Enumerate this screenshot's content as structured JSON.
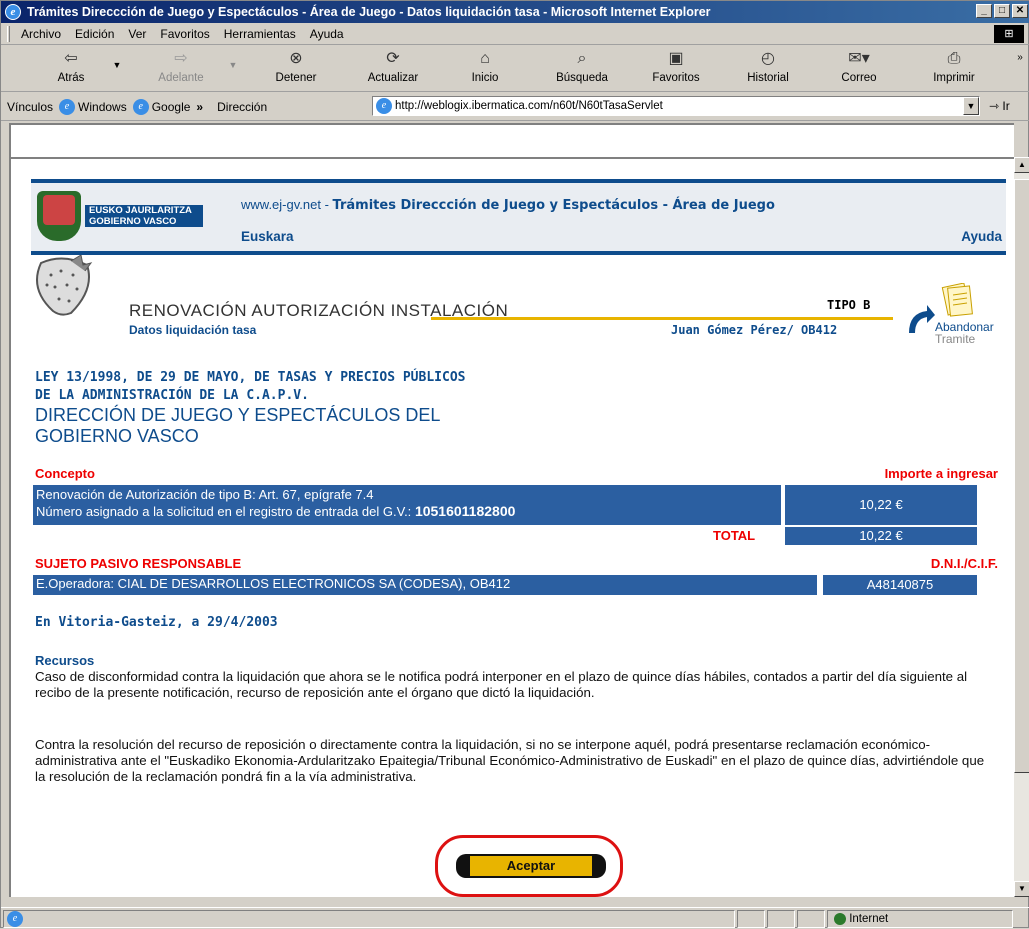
{
  "window": {
    "title": "Trámites Direccción de Juego y Espectáculos - Área de Juego - Datos liquidación tasa - Microsoft Internet Explorer"
  },
  "menu": [
    "Archivo",
    "Edición",
    "Ver",
    "Favoritos",
    "Herramientas",
    "Ayuda"
  ],
  "toolbar": {
    "back": "Atrás",
    "forward": "Adelante",
    "stop": "Detener",
    "refresh": "Actualizar",
    "home": "Inicio",
    "search": "Búsqueda",
    "favorites": "Favoritos",
    "history": "Historial",
    "mail": "Correo",
    "print": "Imprimir"
  },
  "links": {
    "label": "Vínculos",
    "windows": "Windows",
    "google": "Google",
    "more": "»",
    "address_label": "Dirección",
    "url": "http://weblogix.ibermatica.com/n60t/N60tTasaServlet",
    "go": "Ir"
  },
  "banner": {
    "logo_text": "EUSKO JAURLARITZA GOBIERNO VASCO",
    "site": "www.ej-gv.net",
    "sep": " - ",
    "site_title": "Trámites Direccción de Juego y Espectáculos - Área de Juego",
    "euskara": "Euskara",
    "ayuda": "Ayuda"
  },
  "procedure": {
    "title": "RENOVACIÓN AUTORIZACIÓN INSTALACIÓN",
    "tipo": "TIPO B",
    "subtitle": "Datos liquidación tasa",
    "user": "Juan Gómez Pérez/ OB412",
    "abandon_1": "Abandonar",
    "abandon_2": "Tramite"
  },
  "law": {
    "line1": "LEY 13/1998, DE 29 DE MAYO, DE TASAS Y PRECIOS PÚBLICOS",
    "line2": "DE LA ADMINISTRACIÓN DE LA C.A.P.V.",
    "line3": "DIRECCIÓN DE JUEGO Y ESPECTÁCULOS DEL",
    "line4": "GOBIERNO VASCO"
  },
  "concept": {
    "header": "Concepto",
    "amount_header": "Importe a ingresar",
    "line1": "Renovación de Autorización de tipo B: Art. 67, epígrafe 7.4",
    "line2": "Número asignado a la solicitud en el registro de entrada del G.V.:",
    "reg_number": "1051601182800",
    "amount": "10,22 €",
    "total_label": "TOTAL",
    "total": "10,22 €"
  },
  "subject": {
    "header": "SUJETO PASIVO RESPONSABLE",
    "id_header": "D.N.I./C.I.F.",
    "name": "E.Operadora: CIAL DE DESARROLLOS ELECTRONICOS SA (CODESA), OB412",
    "id": "A48140875"
  },
  "place_date": "En Vitoria-Gasteiz, a 29/4/2003",
  "resources": {
    "header": "Recursos",
    "p1": "Caso de disconformidad contra la liquidación que ahora se le notifica podrá interponer en el plazo de quince días hábiles, contados a partir del día siguiente al recibo de la presente notificación, recurso de reposición ante el órgano que dictó la liquidación.",
    "p2": "Contra la resolución del recurso de reposición o directamente contra la liquidación, si no se interpone aquél, podrá presentarse reclamación económico-administrativa ante el \"Euskadiko Ekonomia-Ardularitzako Epaitegia/Tribunal Económico-Administrativo de Euskadi\" en el plazo de quince días, advirtiéndole que la resolución de la reclamación pondrá fin a la vía administrativa."
  },
  "accept_button": "Aceptar",
  "status": {
    "zone": "Internet"
  }
}
